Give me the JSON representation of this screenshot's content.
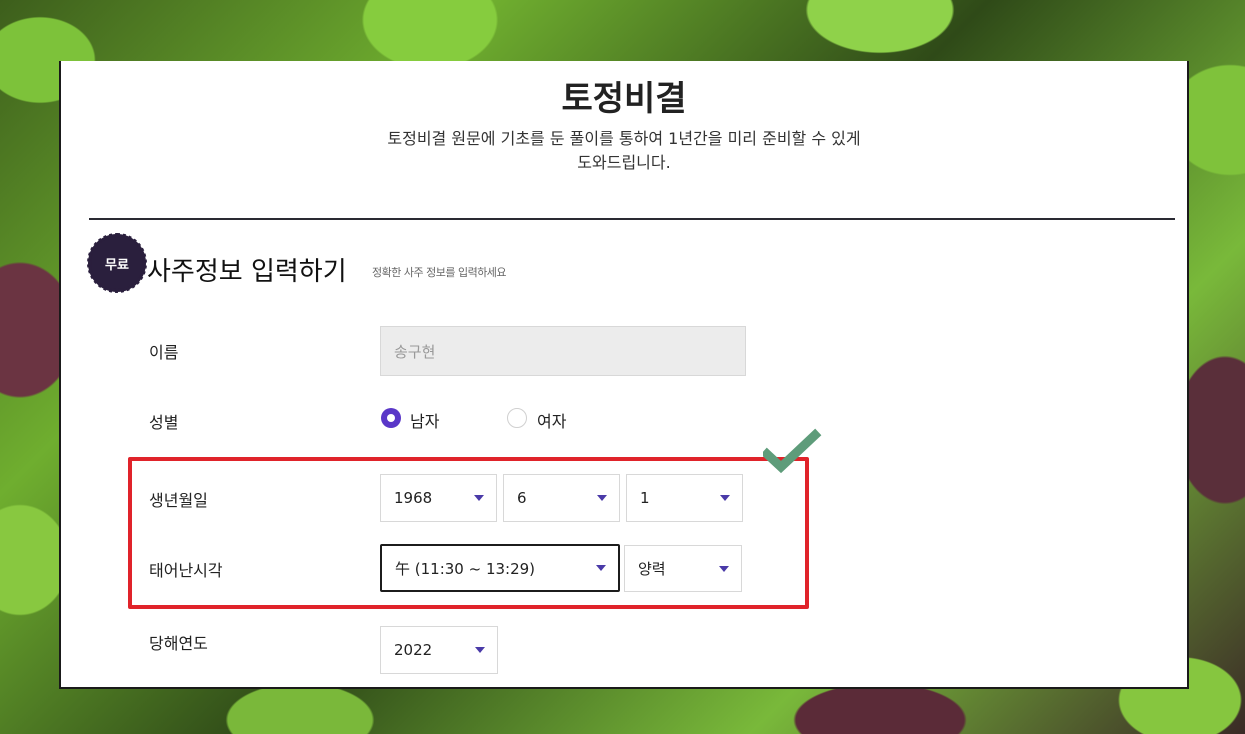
{
  "page": {
    "title": "토정비결",
    "description_line1": "토정비결 원문에 기초를 둔 풀이를 통하여 1년간을 미리 준비할 수 있게",
    "description_line2": "도와드립니다."
  },
  "section": {
    "badge": "무료",
    "title": "사주정보 입력하기",
    "subtitle": "정확한 사주 정보를 입력하세요"
  },
  "form": {
    "name": {
      "label": "이름",
      "value": "송구현"
    },
    "gender": {
      "label": "성별",
      "options": [
        "남자",
        "여자"
      ],
      "selected": "남자"
    },
    "birth": {
      "label": "생년월일",
      "year": "1968",
      "month": "6",
      "day": "1"
    },
    "time": {
      "label": "태어난시각",
      "value": "午 (11:30 ~ 13:29)",
      "calendar": "양력"
    },
    "target_year": {
      "label": "당해연도",
      "value": "2022"
    }
  },
  "colors": {
    "accent": "#5a37c8",
    "highlight": "#e0232a",
    "check": "#5e9c7a",
    "badge": "#2a1f3d"
  },
  "icons": [
    "chevron-down-icon",
    "check-icon",
    "radio-selected-icon",
    "radio-unselected-icon"
  ]
}
